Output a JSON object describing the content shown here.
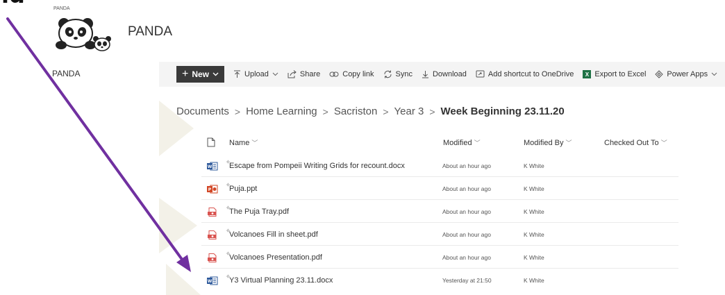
{
  "heading_fragment": "ig",
  "site": {
    "small_label": "PANDA",
    "title": "PANDA"
  },
  "leftnav": {
    "items": [
      {
        "label": "PANDA"
      }
    ]
  },
  "commands": {
    "new": "New",
    "upload": "Upload",
    "share": "Share",
    "copy_link": "Copy link",
    "sync": "Sync",
    "download": "Download",
    "add_shortcut": "Add shortcut to OneDrive",
    "export_excel": "Export to Excel",
    "power_apps": "Power Apps"
  },
  "breadcrumb": [
    "Documents",
    "Home Learning",
    "Sacriston",
    "Year 3"
  ],
  "breadcrumb_current": "Week Beginning 23.11.20",
  "columns": {
    "name": "Name",
    "modified": "Modified",
    "modified_by": "Modified By",
    "checked_out_to": "Checked Out To"
  },
  "files": [
    {
      "type": "word",
      "name": "Escape from Pompeii Writing Grids for recount.docx",
      "modified": "About an hour ago",
      "modified_by": "K White"
    },
    {
      "type": "ppt",
      "name": "Puja.ppt",
      "modified": "About an hour ago",
      "modified_by": "K White"
    },
    {
      "type": "pdf",
      "name": "The Puja Tray.pdf",
      "modified": "About an hour ago",
      "modified_by": "K White"
    },
    {
      "type": "pdf",
      "name": "Volcanoes Fill in sheet.pdf",
      "modified": "About an hour ago",
      "modified_by": "K White"
    },
    {
      "type": "pdf",
      "name": "Volcanoes Presentation.pdf",
      "modified": "About an hour ago",
      "modified_by": "K White"
    },
    {
      "type": "word",
      "name": "Y3 Virtual Planning 23.11.docx",
      "modified": "Yesterday at 21:50",
      "modified_by": "K White"
    }
  ],
  "colors": {
    "arrow": "#7030a0",
    "command_bar": "#f4f4f4",
    "new_button": "#3a3a3a",
    "word": "#2b579a",
    "ppt": "#d24726",
    "pdf": "#d9534f",
    "excel": "#1e7145"
  }
}
